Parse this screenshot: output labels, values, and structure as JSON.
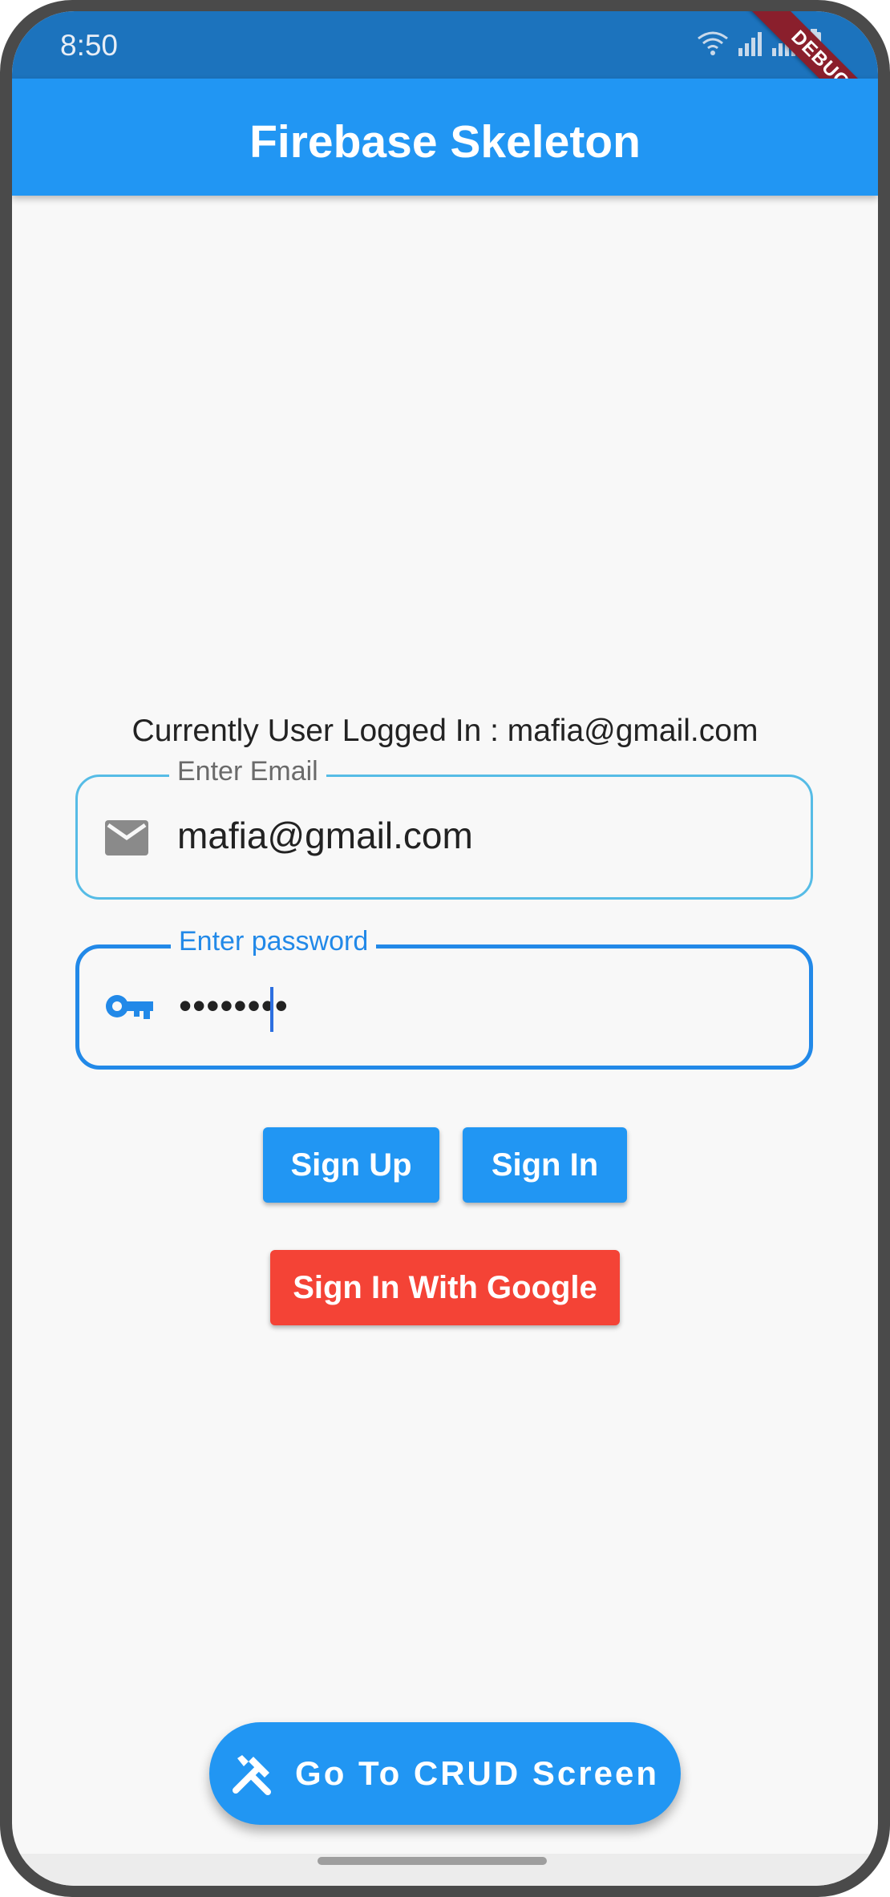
{
  "status_bar": {
    "time": "8:50",
    "icons": [
      "wifi-icon",
      "signal-icon",
      "signal-icon",
      "battery-icon"
    ],
    "debug_banner": "DEBUG"
  },
  "app_bar": {
    "title": "Firebase Skeleton",
    "color": "#2196f3"
  },
  "main": {
    "logged_in_text": "Currently User Logged In : mafia@gmail.com",
    "email_field": {
      "label": "Enter Email",
      "value": "mafia@gmail.com",
      "icon": "mail-icon"
    },
    "password_field": {
      "label": "Enter password",
      "value": "••••••••",
      "icon": "key-icon"
    },
    "buttons": {
      "sign_up": "Sign Up",
      "sign_in": "Sign In",
      "google": "Sign In With Google"
    }
  },
  "fab": {
    "label": "Go To CRUD Screen",
    "icon": "tools-icon"
  },
  "colors": {
    "primary": "#2196f3",
    "danger": "#f44336",
    "status_bar": "#1c73bd"
  }
}
